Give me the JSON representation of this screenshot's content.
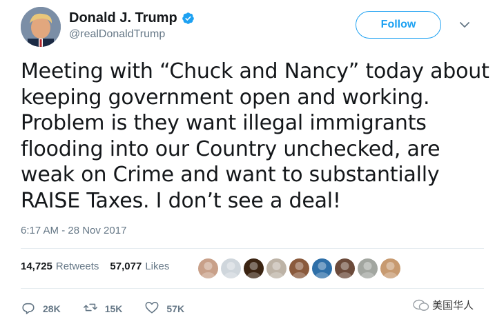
{
  "author": {
    "name": "Donald J. Trump",
    "handle": "@realDonaldTrump",
    "verified_icon": "verified-badge-icon",
    "avatar_icon": "profile-avatar"
  },
  "follow_label": "Follow",
  "tweet": {
    "text": "Meeting with “Chuck and Nancy” today about keeping government open and working. Problem is they want illegal immigrants flooding into our Country unchecked, are weak on Crime and want to substantially RAISE Taxes. I don’t see a deal!",
    "timestamp": "6:17 AM - 28 Nov 2017"
  },
  "stats": {
    "retweets_count": "14,725",
    "retweets_label": "Retweets",
    "likes_count": "57,077",
    "likes_label": "Likes"
  },
  "likers": [
    {
      "color": "#c8a089"
    },
    {
      "color": "#cfd6dc"
    },
    {
      "color": "#3b2412"
    },
    {
      "color": "#bdb3a6"
    },
    {
      "color": "#8a5a3c"
    },
    {
      "color": "#2e6fa8"
    },
    {
      "color": "#6b4a3a"
    },
    {
      "color": "#a2a6a0"
    },
    {
      "color": "#c79a70"
    }
  ],
  "actions": {
    "replies": "28K",
    "retweets": "15K",
    "likes": "57K"
  },
  "watermark": {
    "text": "美国华人"
  },
  "colors": {
    "accent": "#1da1f2",
    "muted": "#657786",
    "text": "#14171a"
  }
}
